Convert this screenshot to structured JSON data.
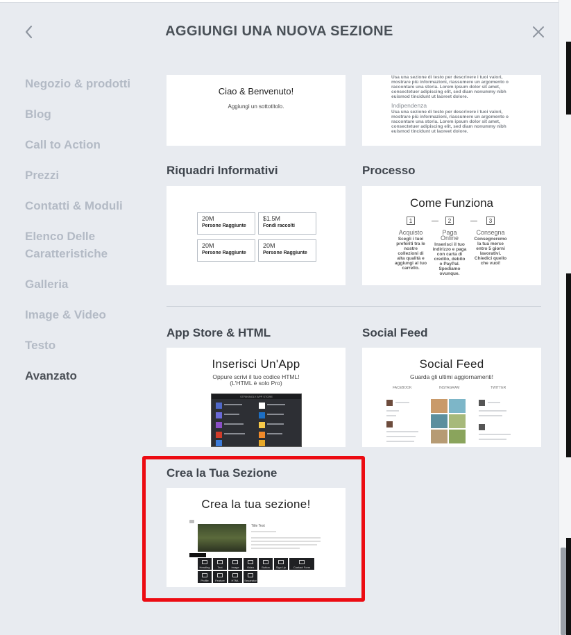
{
  "header": {
    "title": "AGGIUNGI UNA NUOVA SEZIONE",
    "back_icon": "chevron-left-icon",
    "close_icon": "close-icon"
  },
  "sidebar": {
    "items": [
      {
        "label": "Negozio & prodotti",
        "active": false
      },
      {
        "label": "Blog",
        "active": false
      },
      {
        "label": "Call to Action",
        "active": false
      },
      {
        "label": "Prezzi",
        "active": false
      },
      {
        "label": "Contatti & Moduli",
        "active": false
      },
      {
        "label": "Elenco Delle Caratteristiche",
        "active": false
      },
      {
        "label": "Galleria",
        "active": false
      },
      {
        "label": "Image & Video",
        "active": false
      },
      {
        "label": "Testo",
        "active": false
      },
      {
        "label": "Avanzato",
        "active": true
      }
    ]
  },
  "cards": {
    "hello": {
      "preview_title": "Ciao & Benvenuto!",
      "preview_subtitle": "Aggiungi un sottotitolo."
    },
    "text": {
      "para1": "Usa una sezione di testo per descrivere i tuoi valori, mostrare più informazioni, riassumere un argomento o raccontare una storia. Lorem ipsum dolor sit amet, consectetuer adipiscing elit, sed diam nonummy nibh euismod tincidunt ut laoreet dolore.",
      "heading2": "Indipendenza",
      "para2": "Usa una sezione di testo per descrivere i tuoi valori, mostrare più informazioni, riassumere un argomento o raccontare una storia. Lorem ipsum dolor sit amet, consectetuer adipiscing elit, sed diam nonummy nibh euismod tincidunt ut laoreet dolore."
    },
    "info": {
      "label": "Riquadri Informativi",
      "boxes": [
        {
          "value": "20M",
          "label": "Persone Raggiunte"
        },
        {
          "value": "$1.5M",
          "label": "Fondi raccolti"
        },
        {
          "value": "20M",
          "label": "Persone Raggiunte"
        },
        {
          "value": "20M",
          "label": "Persone Raggiunte"
        }
      ]
    },
    "process": {
      "label": "Processo",
      "preview_title": "Come Funziona",
      "steps": [
        {
          "num": "1",
          "head": "Acquisto",
          "body": "Scegli i tuoi preferiti tra le nostre collezioni di alta qualità e aggiungi al tuo carrello."
        },
        {
          "num": "2",
          "head": "Paga Online",
          "body": "Inserisci il tuo indirizzo e paga con carta di credito, debito o PayPal. Spediamo ovunque."
        },
        {
          "num": "3",
          "head": "Consegna",
          "body": "Consegneremo la tua merce entro 5 giorni lavorativi. Chiedici quello che vuoi!"
        }
      ]
    },
    "appstore": {
      "label": "App Store & HTML",
      "preview_title": "Inserisci Un'App",
      "preview_sub1": "Oppure scrivi il tuo codice HTML!",
      "preview_sub2": "(L'HTML è solo Pro)",
      "shot_header": "STRIKINGLY APP STORE"
    },
    "social": {
      "label": "Social Feed",
      "preview_title": "Social Feed",
      "preview_sub": "Guarda gli ultimi aggiornamenti!",
      "col1": "FACEBOOK",
      "col2": "INSTAGRAM",
      "col3": "TWITTER"
    },
    "custom": {
      "label": "Crea la Tua Sezione",
      "preview_title": "Crea la tua sezione!",
      "sample_title": "Title Text",
      "tools_row1": [
        "Heading",
        "Text",
        "Image",
        "Video",
        "Button",
        "Sign Up",
        "Contact Form"
      ],
      "tools_row2": [
        "Profile",
        "Feature",
        "HTML",
        "Separator"
      ]
    }
  },
  "colors": {
    "background": "#e8ebf0",
    "highlight": "#ec0b12",
    "sidebar_inactive": "#b3bac5",
    "sidebar_active": "#4b5057"
  }
}
